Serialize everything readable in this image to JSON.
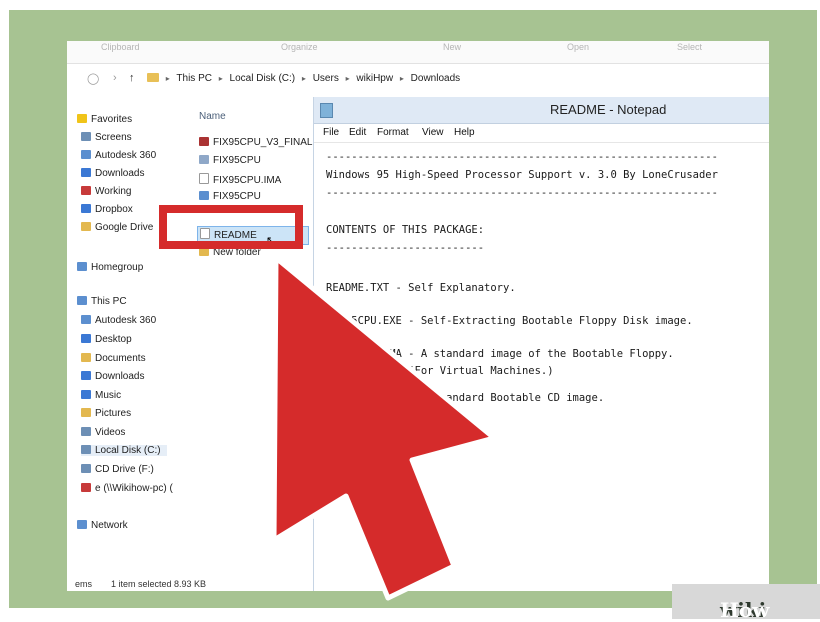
{
  "ribbon": {
    "labels": [
      "Clipboard",
      "Organize",
      "New",
      "Open",
      "Select"
    ]
  },
  "address": {
    "crumbs": [
      "This PC",
      "Local Disk (C:)",
      "Users",
      "wikiHpw",
      "Downloads"
    ]
  },
  "nav_pane": {
    "favorites_header": "Favorites",
    "favorites": [
      "Screens",
      "Autodesk 360",
      "Downloads",
      "Working",
      "Dropbox",
      "Google Drive"
    ],
    "homegroup": "Homegroup",
    "this_pc_header": "This PC",
    "this_pc": [
      "Autodesk 360",
      "Desktop",
      "Documents",
      "Downloads",
      "Music",
      "Pictures",
      "Videos",
      "Local Disk (C:)",
      "CD Drive (F:)",
      "e (\\\\Wikihow-pc) ("
    ],
    "network": "Network"
  },
  "file_list": {
    "column_name": "Name",
    "files": [
      "FIX95CPU_V3_FINAL",
      "FIX95CPU",
      "FIX95CPU.IMA",
      "FIX95CPU",
      "README",
      "New folder"
    ],
    "selected_index": 4
  },
  "status_bar": {
    "items_label": "ems",
    "selected_text": "1 item selected  8.93 KB"
  },
  "notepad": {
    "title": "README - Notepad",
    "menu": [
      "File",
      "Edit",
      "Format",
      "View",
      "Help"
    ],
    "lines": [
      "--------------------------------------------------------------",
      "Windows 95 High-Speed Processor Support v. 3.0 By LoneCrusader",
      "--------------------------------------------------------------",
      "CONTENTS OF THIS PACKAGE:",
      "-------------------------",
      "README.TXT - Self Explanatory.",
      "FIX95CPU.EXE - Self-Extracting Bootable Floppy Disk image.",
      "FIX95CPU.IMA - A standard image of the Bootable Floppy.",
      "             (For Virtual Machines.)",
      "FIX95CPU.ISO - A standard Bootable CD image."
    ]
  },
  "annotation": {
    "color": "#d52b2b",
    "outline": "#ffffff"
  },
  "watermark": {
    "part1": "wiki",
    "part2": "How"
  }
}
